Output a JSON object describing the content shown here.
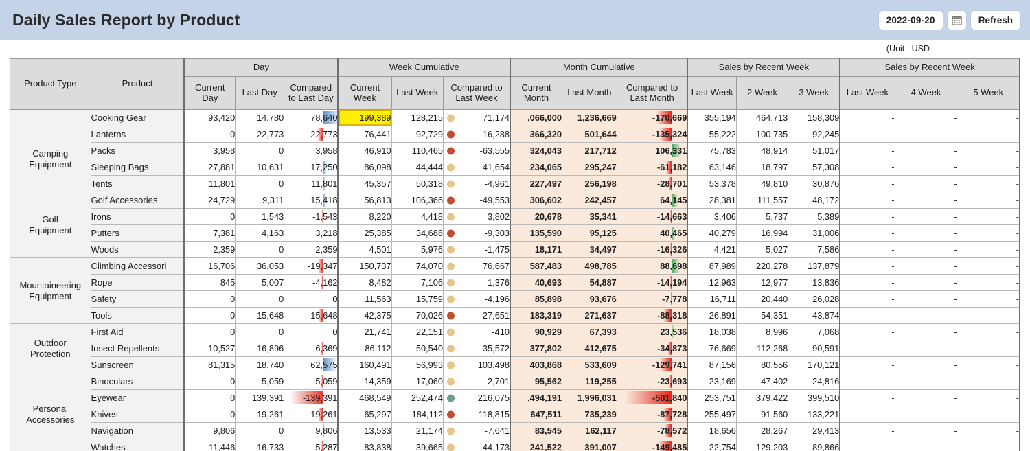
{
  "header": {
    "title": "Daily Sales Report by Product",
    "date_value": "2022-09-20",
    "calendar_icon": "calendar-icon",
    "refresh_label": "Refresh",
    "bar_color": "#c5d3e8"
  },
  "unit_note": "(Unit : USD",
  "table": {
    "group_headers": [
      {
        "label": "Product Type",
        "span": 1,
        "rowspan": 2
      },
      {
        "label": "Product",
        "span": 1,
        "rowspan": 2
      },
      {
        "label": "Day",
        "span": 3
      },
      {
        "label": "Week Cumulative",
        "span": 3
      },
      {
        "label": "Month Cumulative",
        "span": 3
      },
      {
        "label": "Sales by Recent Week",
        "span": 3
      },
      {
        "label": "Sales by Recent Week",
        "span": 3
      }
    ],
    "sub_headers": [
      "Current Day",
      "Last Day",
      "Compared to Last Day",
      "Current Week",
      "Last Week",
      "Compared to Last Week",
      "Current Month",
      "Last Month",
      "Compared to Last Month",
      "Last Week",
      "2 Week",
      "3 Week",
      "Last Week",
      "4 Week",
      "5 Week"
    ],
    "dash": "-",
    "colors": {
      "header_bg": "#dcdcdc",
      "month_bg": "#fbe9dc",
      "highlight_bg": "#ffef00",
      "bar_positive_day": "#5b8fc9",
      "bar_negative_day": "#e03b30",
      "bar_positive_month": "#3faa5a",
      "bar_negative_month": "#e8241a",
      "dot_neutral": "#e4c58a",
      "dot_negative": "#c04e30",
      "dot_positive": "#6d9e8c"
    },
    "rows": [
      {
        "category": "",
        "product": "Cooking Gear",
        "current_day": "93,420",
        "last_day": "14,780",
        "cmp_day": "78,640",
        "cmp_day_v": 78640,
        "current_week": "199,389",
        "week_highlight": true,
        "last_week": "128,215",
        "cmp_week": "71,174",
        "cmp_week_dot": "neutral",
        "current_month": ",066,000",
        "last_month": "1,236,669",
        "cmp_month": "-170,669",
        "cmp_month_v": -170669,
        "w1": "355,194",
        "w2": "464,713",
        "w3": "158,309",
        "r1": "-",
        "r4": "-",
        "r5": "-"
      },
      {
        "category": "Camping Equipment",
        "product": "Lanterns",
        "group_start": true,
        "current_day": "0",
        "last_day": "22,773",
        "cmp_day": "-22,773",
        "cmp_day_v": -22773,
        "current_week": "76,441",
        "last_week": "92,729",
        "cmp_week": "-16,288",
        "cmp_week_dot": "negative",
        "current_month": "366,320",
        "last_month": "501,644",
        "cmp_month": "-135,324",
        "cmp_month_v": -135324,
        "w1": "55,222",
        "w2": "100,735",
        "w3": "92,245",
        "r1": "-",
        "r4": "-",
        "r5": "-"
      },
      {
        "category": "",
        "product": "Packs",
        "current_day": "3,958",
        "last_day": "0",
        "cmp_day": "3,958",
        "cmp_day_v": 3958,
        "current_week": "46,910",
        "last_week": "110,465",
        "cmp_week": "-63,555",
        "cmp_week_dot": "negative",
        "current_month": "324,043",
        "last_month": "217,712",
        "cmp_month": "106,331",
        "cmp_month_v": 106331,
        "w1": "75,783",
        "w2": "48,914",
        "w3": "51,017",
        "r1": "-",
        "r4": "-",
        "r5": "-"
      },
      {
        "category": "",
        "product": "Sleeping Bags",
        "current_day": "27,881",
        "last_day": "10,631",
        "cmp_day": "17,250",
        "cmp_day_v": 17250,
        "current_week": "86,098",
        "last_week": "44,444",
        "cmp_week": "41,654",
        "cmp_week_dot": "neutral",
        "current_month": "234,065",
        "last_month": "295,247",
        "cmp_month": "-61,182",
        "cmp_month_v": -61182,
        "w1": "63,146",
        "w2": "18,797",
        "w3": "57,308",
        "r1": "-",
        "r4": "-",
        "r5": "-"
      },
      {
        "category": "",
        "product": "Tents",
        "current_day": "11,801",
        "last_day": "0",
        "cmp_day": "11,801",
        "cmp_day_v": 11801,
        "current_week": "45,357",
        "last_week": "50,318",
        "cmp_week": "-4,961",
        "cmp_week_dot": "neutral",
        "current_month": "227,497",
        "last_month": "256,198",
        "cmp_month": "-28,701",
        "cmp_month_v": -28701,
        "w1": "53,378",
        "w2": "49,810",
        "w3": "30,876",
        "r1": "-",
        "r4": "-",
        "r5": "-"
      },
      {
        "category": "Golf Equipment",
        "product": "Golf Accessories",
        "group_start": true,
        "current_day": "24,729",
        "last_day": "9,311",
        "cmp_day": "15,418",
        "cmp_day_v": 15418,
        "current_week": "56,813",
        "last_week": "106,366",
        "cmp_week": "-49,553",
        "cmp_week_dot": "negative",
        "current_month": "306,602",
        "last_month": "242,457",
        "cmp_month": "64,145",
        "cmp_month_v": 64145,
        "w1": "28,381",
        "w2": "111,557",
        "w3": "48,172",
        "r1": "-",
        "r4": "-",
        "r5": "-"
      },
      {
        "category": "",
        "product": "Irons",
        "current_day": "0",
        "last_day": "1,543",
        "cmp_day": "-1,543",
        "cmp_day_v": -1543,
        "current_week": "8,220",
        "last_week": "4,418",
        "cmp_week": "3,802",
        "cmp_week_dot": "neutral",
        "current_month": "20,678",
        "last_month": "35,341",
        "cmp_month": "-14,663",
        "cmp_month_v": -14663,
        "w1": "3,406",
        "w2": "5,737",
        "w3": "5,389",
        "r1": "-",
        "r4": "-",
        "r5": "-"
      },
      {
        "category": "",
        "product": "Putters",
        "current_day": "7,381",
        "last_day": "4,163",
        "cmp_day": "3,218",
        "cmp_day_v": 3218,
        "current_week": "25,385",
        "last_week": "34,688",
        "cmp_week": "-9,303",
        "cmp_week_dot": "negative",
        "current_month": "135,590",
        "last_month": "95,125",
        "cmp_month": "40,465",
        "cmp_month_v": 40465,
        "w1": "40,279",
        "w2": "16,994",
        "w3": "31,006",
        "r1": "-",
        "r4": "-",
        "r5": "-"
      },
      {
        "category": "",
        "product": "Woods",
        "current_day": "2,359",
        "last_day": "0",
        "cmp_day": "2,359",
        "cmp_day_v": 2359,
        "current_week": "4,501",
        "last_week": "5,976",
        "cmp_week": "-1,475",
        "cmp_week_dot": "neutral",
        "current_month": "18,171",
        "last_month": "34,497",
        "cmp_month": "-16,326",
        "cmp_month_v": -16326,
        "w1": "4,421",
        "w2": "5,027",
        "w3": "7,586",
        "r1": "-",
        "r4": "-",
        "r5": "-"
      },
      {
        "category": "Mountaineering Equipment",
        "product": "Climbing Accessori",
        "group_start": true,
        "current_day": "16,706",
        "last_day": "36,053",
        "cmp_day": "-19,347",
        "cmp_day_v": -19347,
        "current_week": "150,737",
        "last_week": "74,070",
        "cmp_week": "76,667",
        "cmp_week_dot": "neutral",
        "current_month": "587,483",
        "last_month": "498,785",
        "cmp_month": "88,698",
        "cmp_month_v": 88698,
        "w1": "87,989",
        "w2": "220,278",
        "w3": "137,879",
        "r1": "-",
        "r4": "-",
        "r5": "-"
      },
      {
        "category": "",
        "product": "Rope",
        "current_day": "845",
        "last_day": "5,007",
        "cmp_day": "-4,162",
        "cmp_day_v": -4162,
        "current_week": "8,482",
        "last_week": "7,106",
        "cmp_week": "1,376",
        "cmp_week_dot": "neutral",
        "current_month": "40,693",
        "last_month": "54,887",
        "cmp_month": "-14,194",
        "cmp_month_v": -14194,
        "w1": "12,963",
        "w2": "12,977",
        "w3": "13,836",
        "r1": "-",
        "r4": "-",
        "r5": "-"
      },
      {
        "category": "",
        "product": "Safety",
        "current_day": "0",
        "last_day": "0",
        "cmp_day": "0",
        "cmp_day_v": 0,
        "current_week": "11,563",
        "last_week": "15,759",
        "cmp_week": "-4,196",
        "cmp_week_dot": "neutral",
        "current_month": "85,898",
        "last_month": "93,676",
        "cmp_month": "-7,778",
        "cmp_month_v": -7778,
        "w1": "16,711",
        "w2": "20,440",
        "w3": "26,028",
        "r1": "-",
        "r4": "-",
        "r5": "-"
      },
      {
        "category": "",
        "product": "Tools",
        "current_day": "0",
        "last_day": "15,648",
        "cmp_day": "-15,648",
        "cmp_day_v": -15648,
        "current_week": "42,375",
        "last_week": "70,026",
        "cmp_week": "-27,651",
        "cmp_week_dot": "negative",
        "current_month": "183,319",
        "last_month": "271,637",
        "cmp_month": "-88,318",
        "cmp_month_v": -88318,
        "w1": "26,891",
        "w2": "54,351",
        "w3": "43,874",
        "r1": "-",
        "r4": "-",
        "r5": "-"
      },
      {
        "category": "Outdoor Protection",
        "product": "First Aid",
        "group_start": true,
        "current_day": "0",
        "last_day": "0",
        "cmp_day": "0",
        "cmp_day_v": 0,
        "current_week": "21,741",
        "last_week": "22,151",
        "cmp_week": "-410",
        "cmp_week_dot": "neutral",
        "current_month": "90,929",
        "last_month": "67,393",
        "cmp_month": "23,536",
        "cmp_month_v": 23536,
        "w1": "18,038",
        "w2": "8,996",
        "w3": "7,068",
        "r1": "-",
        "r4": "-",
        "r5": "-"
      },
      {
        "category": "",
        "product": "Insect Repellents",
        "current_day": "10,527",
        "last_day": "16,896",
        "cmp_day": "-6,369",
        "cmp_day_v": -6369,
        "current_week": "86,112",
        "last_week": "50,540",
        "cmp_week": "35,572",
        "cmp_week_dot": "neutral",
        "current_month": "377,802",
        "last_month": "412,675",
        "cmp_month": "-34,873",
        "cmp_month_v": -34873,
        "w1": "76,669",
        "w2": "112,268",
        "w3": "90,591",
        "r1": "-",
        "r4": "-",
        "r5": "-"
      },
      {
        "category": "",
        "product": "Sunscreen",
        "current_day": "81,315",
        "last_day": "18,740",
        "cmp_day": "62,575",
        "cmp_day_v": 62575,
        "current_week": "160,491",
        "last_week": "56,993",
        "cmp_week": "103,498",
        "cmp_week_dot": "neutral",
        "current_month": "403,868",
        "last_month": "533,609",
        "cmp_month": "-129,741",
        "cmp_month_v": -129741,
        "w1": "87,156",
        "w2": "80,556",
        "w3": "170,121",
        "r1": "-",
        "r4": "-",
        "r5": "-"
      },
      {
        "category": "Personal Accessories",
        "product": "Binoculars",
        "group_start": true,
        "current_day": "0",
        "last_day": "5,059",
        "cmp_day": "-5,059",
        "cmp_day_v": -5059,
        "current_week": "14,359",
        "last_week": "17,060",
        "cmp_week": "-2,701",
        "cmp_week_dot": "neutral",
        "current_month": "95,562",
        "last_month": "119,255",
        "cmp_month": "-23,693",
        "cmp_month_v": -23693,
        "w1": "23,169",
        "w2": "47,402",
        "w3": "24,816",
        "r1": "-",
        "r4": "-",
        "r5": "-"
      },
      {
        "category": "",
        "product": "Eyewear",
        "current_day": "0",
        "last_day": "139,391",
        "cmp_day": "-139,391",
        "cmp_day_v": -139391,
        "current_week": "468,549",
        "last_week": "252,474",
        "cmp_week": "216,075",
        "cmp_week_dot": "positive",
        "current_month": ",494,191",
        "last_month": "1,996,031",
        "cmp_month": "-501,840",
        "cmp_month_v": -501840,
        "w1": "253,751",
        "w2": "379,422",
        "w3": "399,510",
        "r1": "-",
        "r4": "-",
        "r5": "-"
      },
      {
        "category": "",
        "product": "Knives",
        "current_day": "0",
        "last_day": "19,261",
        "cmp_day": "-19,261",
        "cmp_day_v": -19261,
        "current_week": "65,297",
        "last_week": "184,112",
        "cmp_week": "-118,815",
        "cmp_week_dot": "negative",
        "current_month": "647,511",
        "last_month": "735,239",
        "cmp_month": "-87,728",
        "cmp_month_v": -87728,
        "w1": "255,497",
        "w2": "91,560",
        "w3": "133,221",
        "r1": "-",
        "r4": "-",
        "r5": "-"
      },
      {
        "category": "",
        "product": "Navigation",
        "current_day": "9,806",
        "last_day": "0",
        "cmp_day": "9,806",
        "cmp_day_v": 9806,
        "current_week": "13,533",
        "last_week": "21,174",
        "cmp_week": "-7,641",
        "cmp_week_dot": "neutral",
        "current_month": "83,545",
        "last_month": "162,117",
        "cmp_month": "-78,572",
        "cmp_month_v": -78572,
        "w1": "18,656",
        "w2": "28,267",
        "w3": "29,413",
        "r1": "-",
        "r4": "-",
        "r5": "-"
      },
      {
        "category": "",
        "product": "Watches",
        "current_day": "11,446",
        "last_day": "16,733",
        "cmp_day": "-5,287",
        "cmp_day_v": -5287,
        "current_week": "83,838",
        "last_week": "39,665",
        "cmp_week": "44,173",
        "cmp_week_dot": "neutral",
        "current_month": "241,522",
        "last_month": "391,007",
        "cmp_month": "-149,485",
        "cmp_month_v": -149485,
        "w1": "22,754",
        "w2": "129,203",
        "w3": "89,866",
        "r1": "-",
        "r4": "-",
        "r5": "-"
      }
    ],
    "category_spans": [
      {
        "label": "Camping Equipment",
        "start": 1,
        "rows": 4
      },
      {
        "label": "Golf Equipment",
        "start": 5,
        "rows": 4
      },
      {
        "label": "Mountaineering Equipment",
        "start": 9,
        "rows": 4
      },
      {
        "label": "Outdoor Protection",
        "start": 13,
        "rows": 3
      },
      {
        "label": "Personal Accessories",
        "start": 16,
        "rows": 5
      }
    ]
  }
}
